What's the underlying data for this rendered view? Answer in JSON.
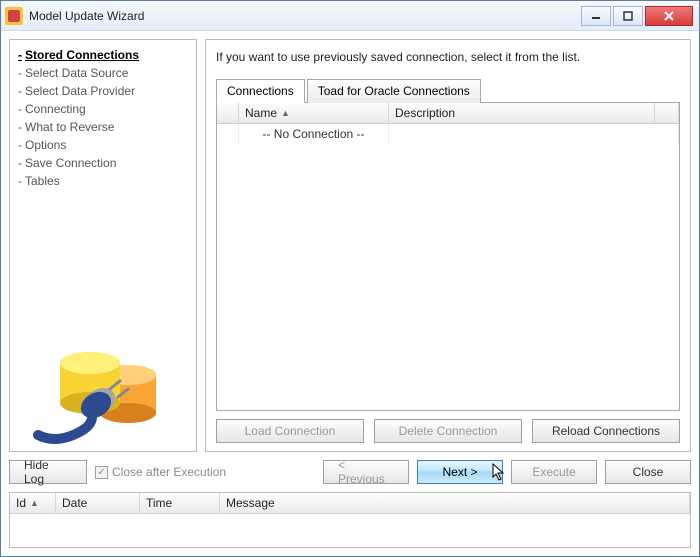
{
  "window": {
    "title": "Model Update Wizard"
  },
  "sidebar": {
    "steps": [
      {
        "label": "Stored Connections",
        "active": true
      },
      {
        "label": "Select Data Source",
        "active": false
      },
      {
        "label": "Select Data Provider",
        "active": false
      },
      {
        "label": "Connecting",
        "active": false
      },
      {
        "label": "What to Reverse",
        "active": false
      },
      {
        "label": "Options",
        "active": false
      },
      {
        "label": "Save Connection",
        "active": false
      },
      {
        "label": "Tables",
        "active": false
      }
    ]
  },
  "main": {
    "instruction": "If you want to use previously saved connection, select it from the list.",
    "tabs": [
      {
        "label": "Connections",
        "active": true
      },
      {
        "label": "Toad for Oracle Connections",
        "active": false
      }
    ],
    "grid": {
      "columns": {
        "name": "Name",
        "description": "Description"
      },
      "rows": [
        {
          "name": "-- No Connection --",
          "description": ""
        }
      ]
    },
    "buttons": {
      "load": "Load Connection",
      "delete": "Delete Connection",
      "reload": "Reload Connections"
    }
  },
  "footer": {
    "hide_log": "Hide Log",
    "close_after_exec": "Close after Execution",
    "previous": "< Previous",
    "next": "Next >",
    "execute": "Execute",
    "close": "Close"
  },
  "log": {
    "columns": {
      "id": "Id",
      "date": "Date",
      "time": "Time",
      "message": "Message"
    }
  },
  "icons": {
    "min": "minimize-icon",
    "max": "maximize-icon",
    "close": "close-icon"
  }
}
